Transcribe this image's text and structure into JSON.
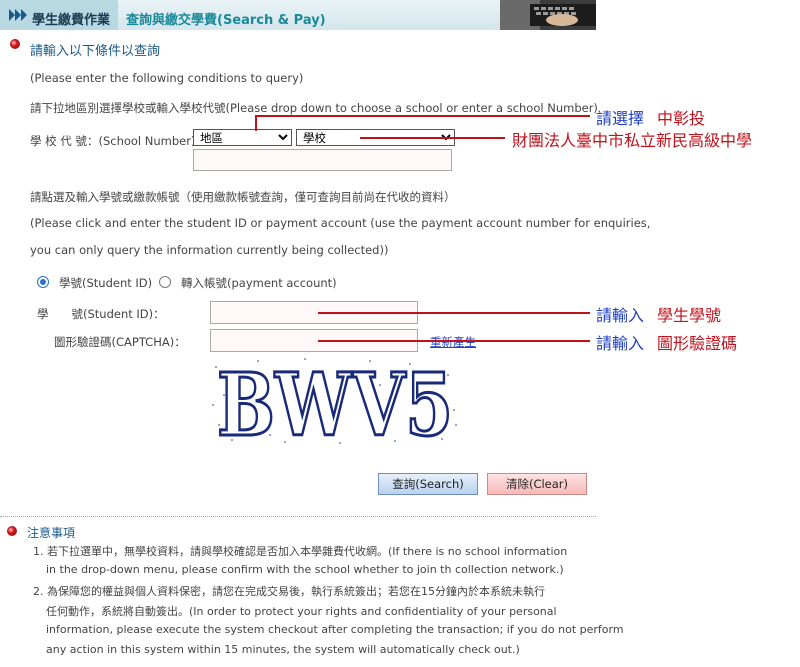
{
  "header": {
    "title": "學生繳費作業",
    "subtitle": "查詢與繳交學費(Search & Pay)"
  },
  "query": {
    "section_title": "請輸入以下條件以查詢",
    "line1": "(Please enter the following conditions to query)",
    "line2": "請下拉地區別選擇學校或輸入學校代號(Please drop down to choose a school or enter a school Number)",
    "school_label": "學 校 代 號：(School Number)",
    "region_selected": "地區",
    "school_selected": "學校",
    "hint1": "請點選及輸入學號或繳款帳號（使用繳款帳號查詢，僅可查詢目前尚在代收的資料）",
    "hint2": "(Please click and enter the student ID or payment account (use the payment account number for enquiries,",
    "hint3": "you can only query the information currently being collected))",
    "radio_student": "學號(Student ID)",
    "radio_account": "轉入帳號(payment account)",
    "student_id_label": "學　　號(Student ID)：",
    "captcha_label": "圖形驗證碼(CAPTCHA)：",
    "captcha_refresh": "重新產生",
    "captcha_text": "BWV5",
    "search_button": "查詢(Search)",
    "clear_button": "清除(Clear)"
  },
  "notes": {
    "title": "注意事項",
    "item1_line1": "1. 若下拉選單中，無學校資料，請與學校確認是否加入本學雜費代收網。(If there is no school information",
    "item1_line2": "in the drop-down menu, please confirm with the school whether to join th collection network.)",
    "item2_line1": "2. 為保障您的權益與個人資料保密，請您在完成交易後，執行系統簽出；若您在15分鐘內於本系統未執行",
    "item2_line2": "任何動作，系統將自動簽出。(In order to protect your rights and confidentiality of your personal",
    "item2_line3": "information, please execute the system checkout after completing the transaction; if you do not perform",
    "item2_line4": "any action in this system within 15 minutes, the system will automatically check out.)"
  },
  "annotations": {
    "select_prefix": "請選擇",
    "select_value": "中彰投",
    "school_name": "財團法人臺中市私立新民高級中學",
    "input_prefix1": "請輸入",
    "input_value1": "學生學號",
    "input_prefix2": "請輸入",
    "input_value2": "圖形驗證碼"
  },
  "colors": {
    "header_bg": "#d5e6ec",
    "title_color": "#1a5a8a",
    "annotation_red": "#c0121c",
    "annotation_blue": "#1f3fbf",
    "captcha_ink": "#1a2a7a"
  }
}
